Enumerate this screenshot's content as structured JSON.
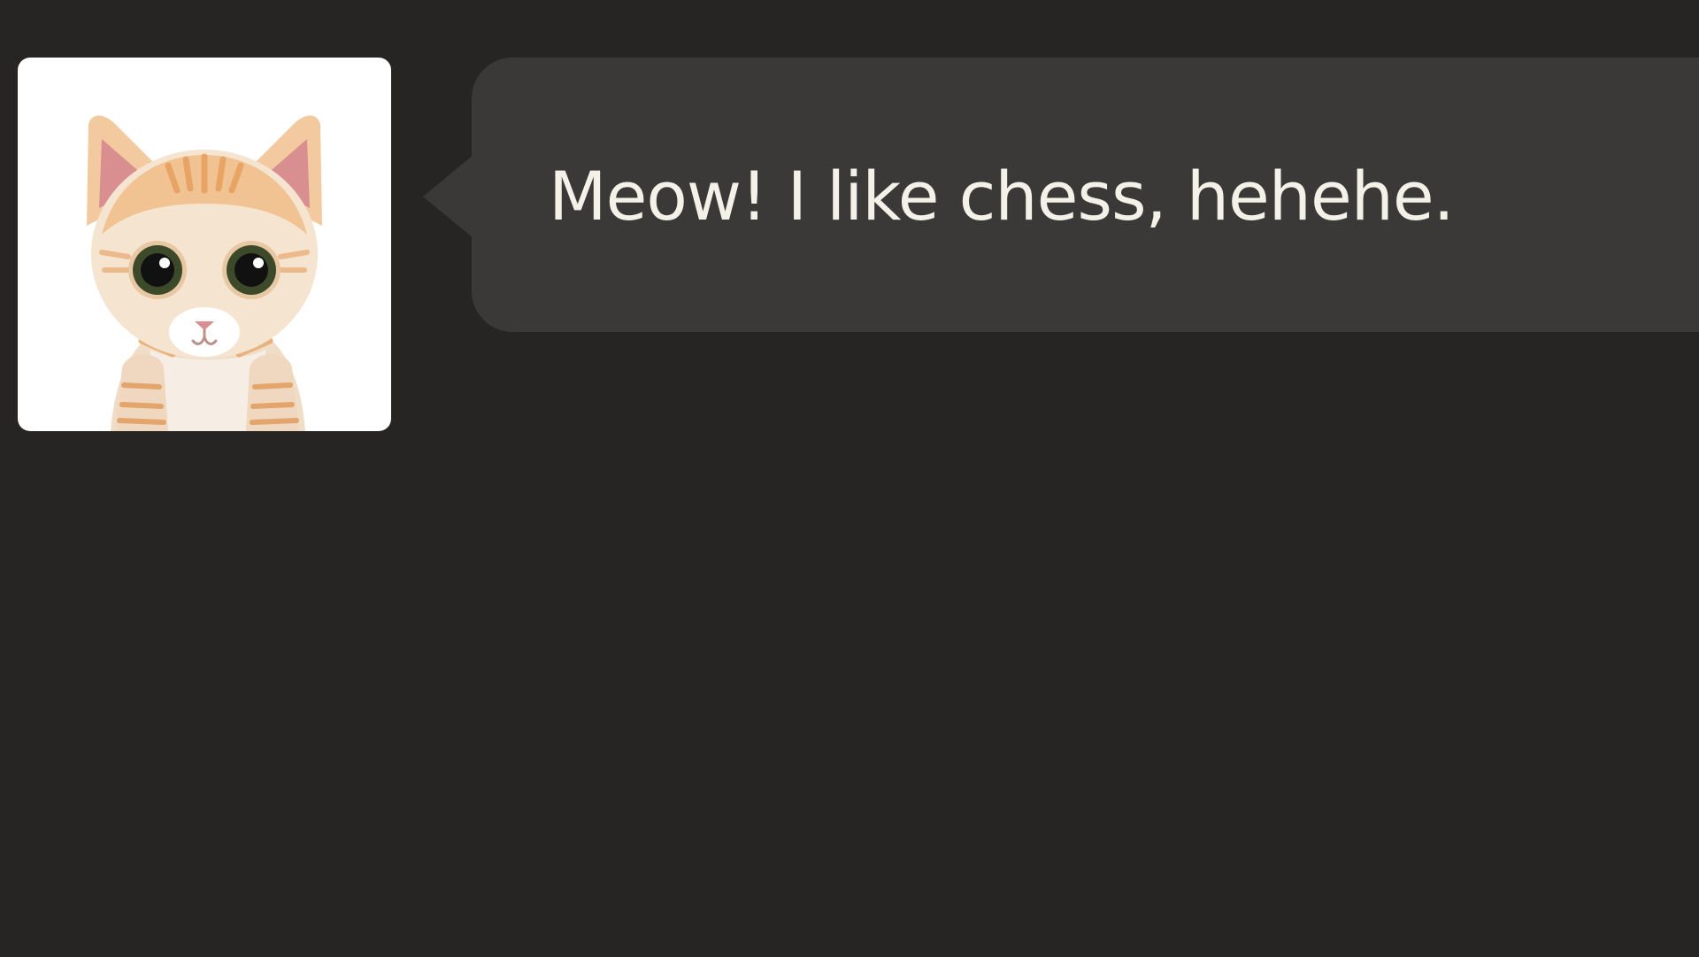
{
  "chat": {
    "message": {
      "text": "Meow! I like chess, hehehe.",
      "avatar_icon": "kitten-avatar-icon"
    }
  },
  "colors": {
    "background": "#262523",
    "bubble": "#3a3938",
    "text": "#f3f1e8",
    "avatar_bg": "#ffffff"
  }
}
